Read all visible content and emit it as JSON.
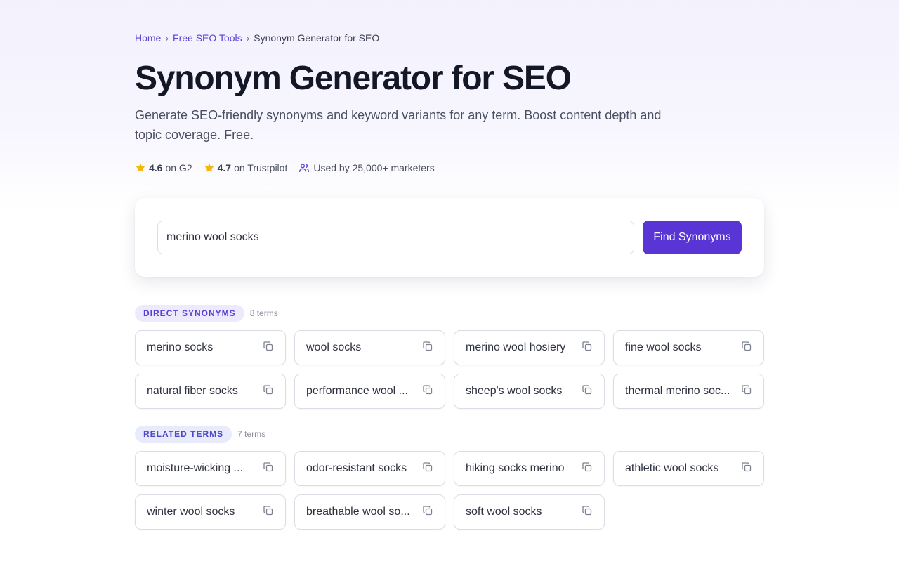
{
  "breadcrumb": {
    "home": "Home",
    "tools": "Free SEO Tools",
    "current": "Synonym Generator for SEO",
    "separator": "›"
  },
  "page": {
    "title": "Synonym Generator for SEO",
    "subtitle": "Generate SEO-friendly synonyms and keyword variants for any term. Boost content depth and topic coverage. Free."
  },
  "ratings": {
    "g2_score": "4.6",
    "g2_label": "on G2",
    "trustpilot_score": "4.7",
    "trustpilot_label": "on Trustpilot",
    "users_label": "Used by 25,000+ marketers",
    "icons": [
      "star-icon",
      "star-icon",
      "users-icon"
    ]
  },
  "search": {
    "value": "merino wool socks",
    "button_label": "Find Synonyms"
  },
  "direct": {
    "label": "DIRECT SYNONYMS",
    "count": "8 terms",
    "items": [
      "merino socks",
      "wool socks",
      "merino wool hosiery",
      "fine wool socks",
      "natural fiber socks",
      "performance wool ...",
      "sheep's wool socks",
      "thermal merino soc..."
    ]
  },
  "related": {
    "label": "RELATED TERMS",
    "count": "7 terms",
    "items": [
      "moisture-wicking ...",
      "odor-resistant socks",
      "hiking socks merino",
      "athletic wool socks",
      "winter wool socks",
      "breathable wool so...",
      "soft wool socks"
    ]
  },
  "colors": {
    "accent": "#5a35d6",
    "star": "#f2b80c",
    "text": "#141826"
  }
}
